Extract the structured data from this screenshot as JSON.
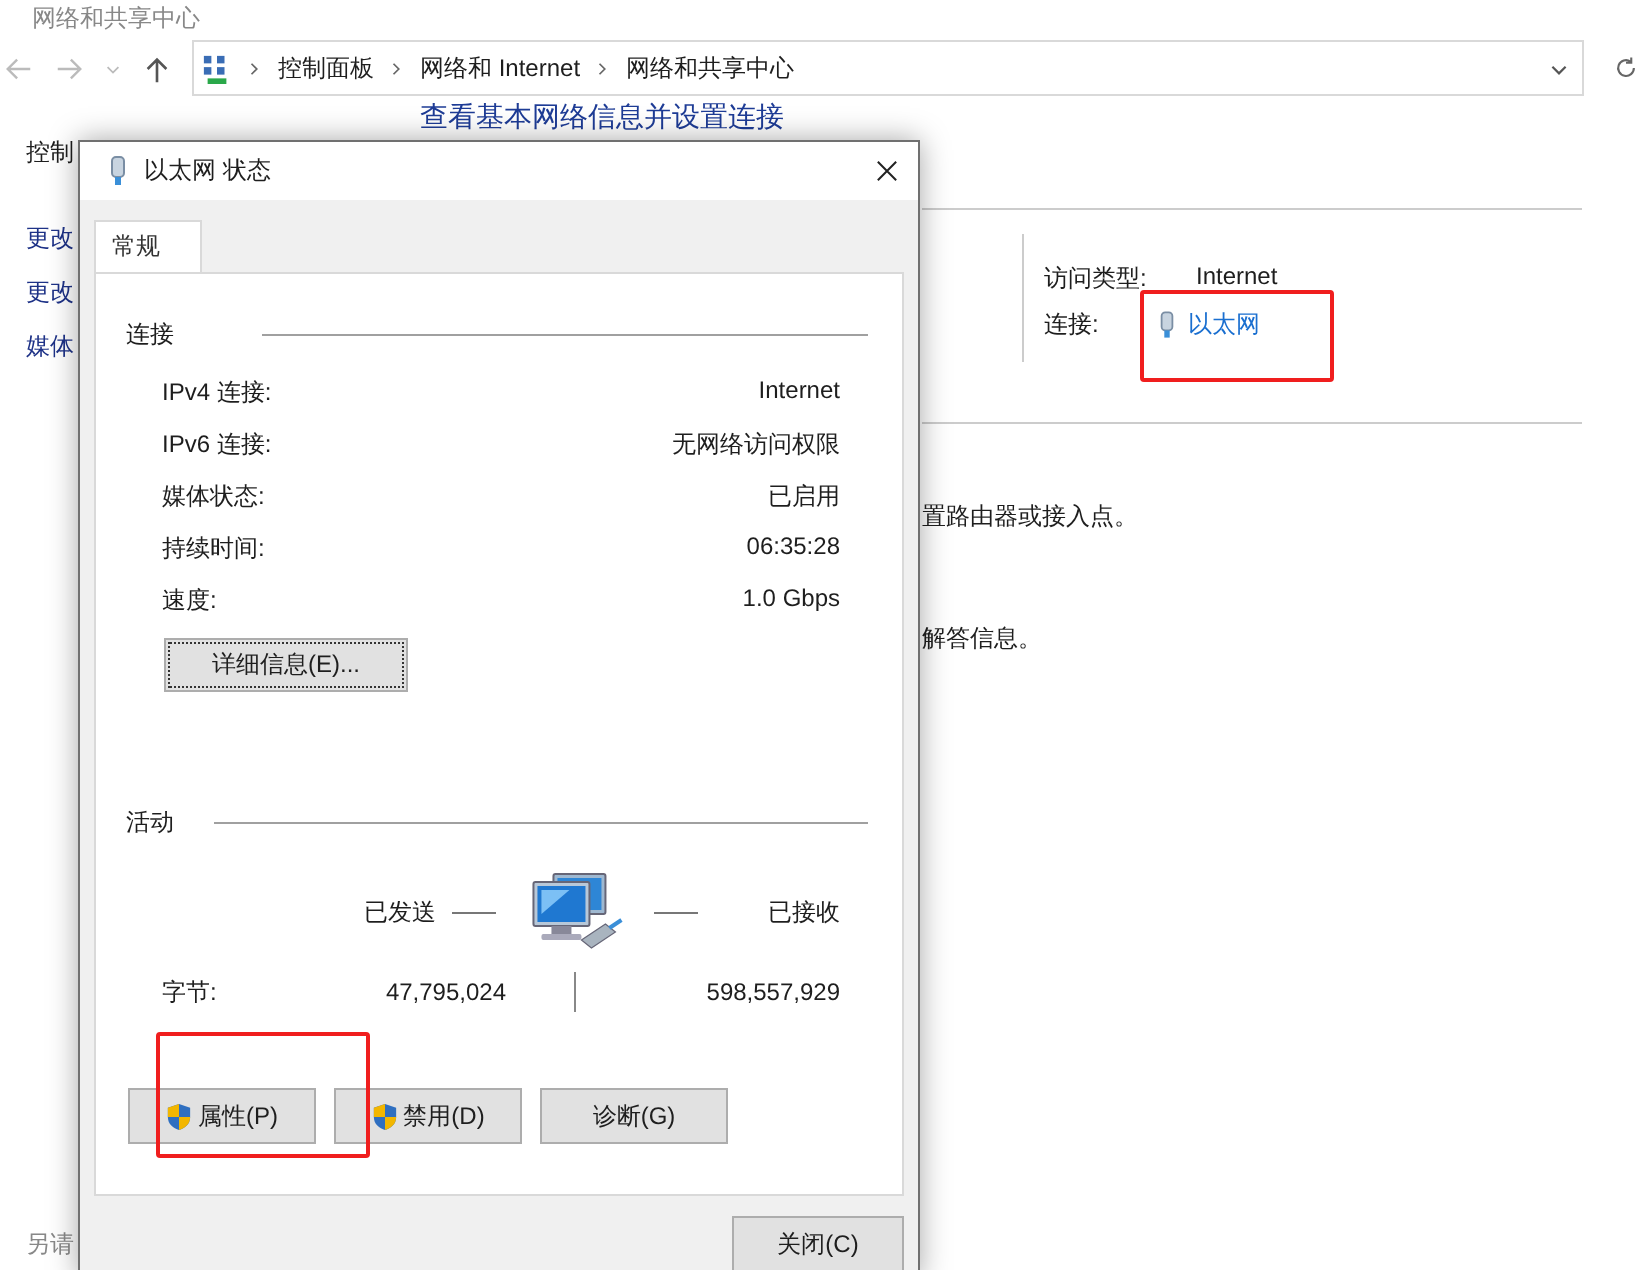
{
  "window": {
    "title": "网络和共享中心"
  },
  "address_bar": {
    "path": [
      "控制面板",
      "网络和 Internet",
      "网络和共享中心"
    ]
  },
  "sidebar": {
    "items": [
      "控制",
      "更改",
      "更改",
      "媒体"
    ],
    "footer": "另请"
  },
  "heading": "查看基本网络信息并设置连接",
  "network_info": [
    {
      "label": "访问类型:",
      "value": "Internet",
      "kind": "text"
    },
    {
      "label": "连接:",
      "value": "以太网",
      "kind": "link"
    }
  ],
  "hints": [
    "置路由器或接入点。",
    "解答信息。"
  ],
  "dialog": {
    "title": "以太网 状态",
    "tabs": [
      {
        "label": "常规",
        "selected": true
      }
    ],
    "connection": {
      "title": "连接",
      "rows": [
        {
          "label": "IPv4 连接:",
          "value": "Internet"
        },
        {
          "label": "IPv6 连接:",
          "value": "无网络访问权限"
        },
        {
          "label": "媒体状态:",
          "value": "已启用"
        },
        {
          "label": "持续时间:",
          "value": "06:35:28"
        },
        {
          "label": "速度:",
          "value": "1.0 Gbps"
        }
      ],
      "details_button": "详细信息(E)..."
    },
    "activity": {
      "title": "活动",
      "sent_label": "已发送",
      "received_label": "已接收",
      "bytes_label": "字节:",
      "bytes_sent": "47,795,024",
      "bytes_received": "598,557,929"
    },
    "buttons": [
      {
        "label": "属性(P)",
        "shield": true
      },
      {
        "label": "禁用(D)",
        "shield": true
      },
      {
        "label": "诊断(G)",
        "shield": false
      }
    ],
    "close_button": "关闭(C)"
  }
}
